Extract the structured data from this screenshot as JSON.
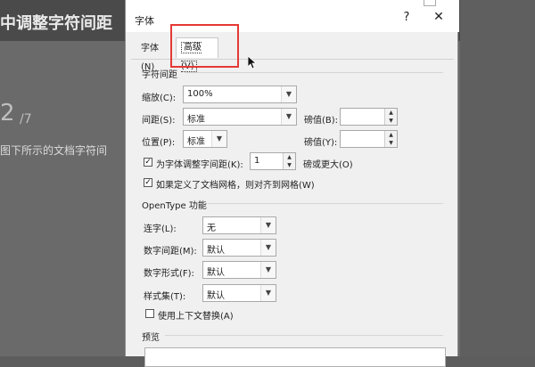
{
  "background": {
    "title": "中调整字符间距",
    "page_num": "2",
    "page_total": "/7",
    "description": "图下所示的文档字符间"
  },
  "dialog": {
    "title": "字体",
    "help": "?",
    "close": "✕",
    "tabs": [
      {
        "label": "字体(N)"
      },
      {
        "label": "高级(V)"
      }
    ],
    "spacing_section": "字符间距",
    "scale": {
      "label": "缩放(C):",
      "value": "100%"
    },
    "spacing": {
      "label": "间距(S):",
      "value": "标准",
      "by_label": "磅值(B):",
      "by_value": ""
    },
    "position": {
      "label": "位置(P):",
      "value": "标准",
      "by_label": "磅值(Y):",
      "by_value": ""
    },
    "kerning": {
      "checked": true,
      "label": "为字体调整字间距(K):",
      "value": "1",
      "suffix": "磅或更大(O)"
    },
    "snap_grid": {
      "checked": true,
      "label": "如果定义了文档网格，则对齐到网格(W)"
    },
    "opentype_section": "OpenType 功能",
    "ligatures": {
      "label": "连字(L):",
      "value": "无"
    },
    "number_spacing": {
      "label": "数字间距(M):",
      "value": "默认"
    },
    "number_forms": {
      "label": "数字形式(F):",
      "value": "默认"
    },
    "stylistic_sets": {
      "label": "样式集(T):",
      "value": "默认"
    },
    "contextual": {
      "checked": false,
      "label": "使用上下文替换(A)"
    },
    "preview_section": "预览"
  },
  "colors": {
    "highlight": "#e53935",
    "dialog_bg": "#f0f0f0"
  }
}
